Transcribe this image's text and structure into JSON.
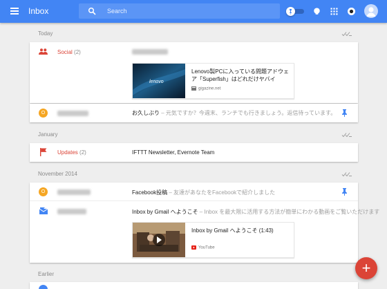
{
  "header": {
    "app_title": "Inbox",
    "search_placeholder": "Search",
    "brand_color": "#4285f4"
  },
  "sections": {
    "today": "Today",
    "january": "January",
    "nov2014": "November 2014",
    "earlier": "Earlier"
  },
  "today": {
    "social": {
      "category": "Social",
      "count": "(2)",
      "preview_title": "Lenovo製PCに入っている問題アドウェア「Superfish」はどれだけヤバイ",
      "preview_source": "gigazine.net",
      "thumb_logo": "lenovo"
    },
    "row2": {
      "avatar_letter": "O",
      "subject": "お久しぶり",
      "snippet": " – 元気ですか？今週末、ランチでも行きましょう。返信待っています。"
    }
  },
  "january": {
    "updates": {
      "category": "Updates",
      "count": "(2)",
      "subject": "IFTTT Newsletter, Evernote Team"
    }
  },
  "nov2014": {
    "row1": {
      "avatar_letter": "O",
      "subject": "Facebook投稿",
      "snippet": " – 友達があなたをFacebookで紹介しました"
    },
    "row2": {
      "subject": "Inbox by Gmail へようこそ",
      "snippet": " – Inbox を最大限に活用する方法が簡単にわかる動画をご覧いただけます",
      "preview_title": "Inbox by Gmail へようこそ (1:43)",
      "preview_source": "YouTube"
    }
  },
  "fab": {
    "label": "+"
  },
  "icons": {
    "menu": "hamburger-icon",
    "search": "search-icon",
    "pin_toggle": "pin-toggle-icon",
    "reminder": "reminder-icon",
    "apps": "apps-grid-icon",
    "notifications": "notifications-icon",
    "account": "account-avatar-icon",
    "social": "people-icon",
    "updates": "flag-icon",
    "promo": "envelope-icon",
    "pin": "pin-icon",
    "sweep": "sweep-icon"
  }
}
